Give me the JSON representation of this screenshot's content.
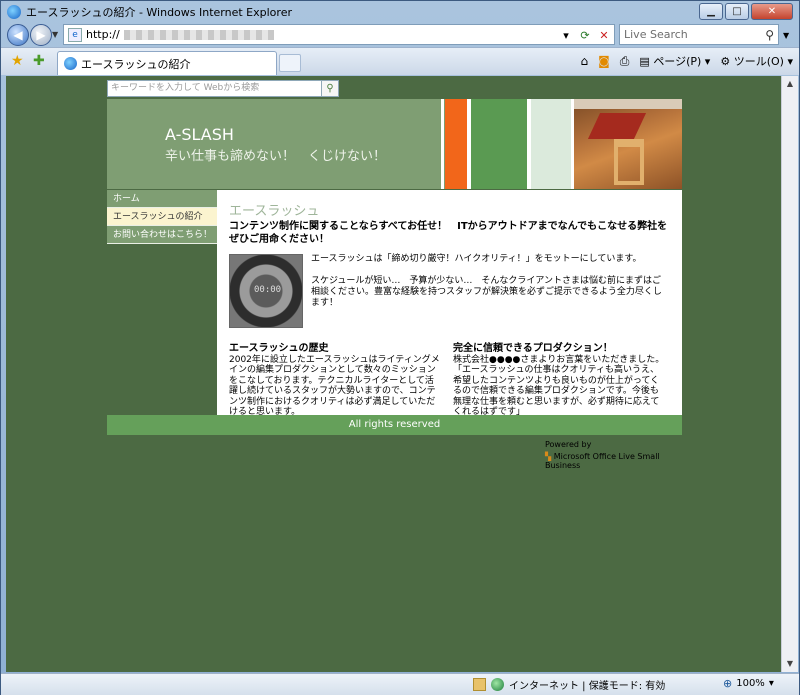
{
  "window": {
    "title": "エースラッシュの紹介 - Windows Internet Explorer"
  },
  "address": {
    "url_prefix": "http://",
    "search_placeholder": "Live Search"
  },
  "tab": {
    "title": "エースラッシュの紹介"
  },
  "commandbar": {
    "page_label": "ページ(P)",
    "tools_label": "ツール(O)"
  },
  "site": {
    "search_placeholder": "キーワードを入力して Webから検索",
    "name": "A-SLASH",
    "tagline": "辛い仕事も諦めない！　くじけない！",
    "nav": [
      {
        "label": "ホーム"
      },
      {
        "label": "エースラッシュの紹介"
      },
      {
        "label": "お問い合わせはこちら！"
      }
    ],
    "heading": "エースラッシュ",
    "lead": "コンテンツ制作に関することならすべてお任せ！　ITからアウトドアまでなんでもこなせる弊社をぜひご用命ください！",
    "intro_p1": "エースラッシュは「締め切り厳守！ハイクオリティ！」をモットーにしています。",
    "intro_p2": "スケジュールが短い…　予算が少ない…　そんなクライアントさまは悩む前にまずはご相談ください。豊富な経験を持つスタッフが解決策を必ずご提示できるよう全力尽くします！",
    "thumb_digits": "00:00",
    "history_title": "エースラッシュの歴史",
    "history_body": "2002年に設立したエースラッシュはライティングメインの編集プロダクションとして数々のミッションをこなしております。テクニカルライターとして活躍し続けているスタッフが大勢いますので、コンテンツ制作におけるクオリティは必ず満足していただけると思います。",
    "trust_title": "完全に信頼できるプロダクション！",
    "trust_body": "株式会社●●●●さまよりお言葉をいただきました。「エースラッシュの仕事はクオリティも高いうえ、希望したコンテンツよりも良いものが仕上がってくるので信頼できる編集プロダクションです。今後も無理な仕事を頼むと思いますが、必ず期待に応えてくれるはずです」",
    "footer": "All rights reserved",
    "powered_by": "Powered by",
    "powered_product": "Microsoft Office Live Small Business"
  },
  "status": {
    "zone": "インターネット | 保護モード: 有効",
    "zoom": "100%"
  },
  "colors": {
    "header_green": "#7f9e73",
    "footer_green": "#65a05a",
    "stripe_orange": "#f2661a",
    "stripe_green": "#5a9a52",
    "stripe_light": "#dbeadc",
    "viewport_bg": "#4c6a43"
  }
}
